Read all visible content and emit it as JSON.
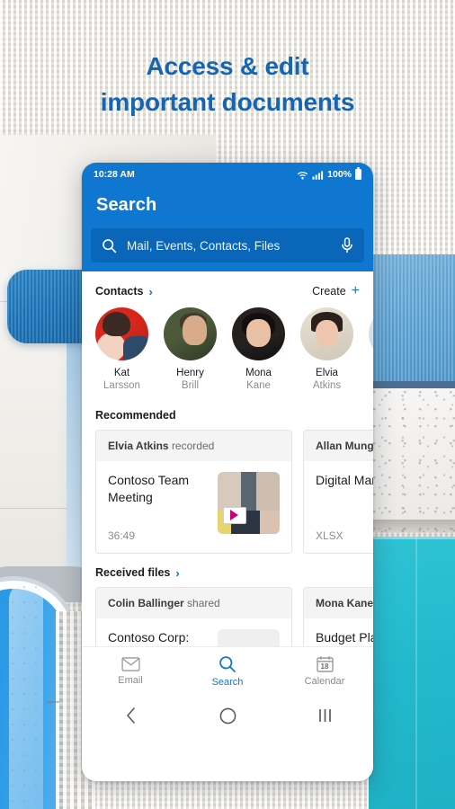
{
  "headline": {
    "line1": "Access & edit",
    "line2": "important documents",
    "color": "#1565b0"
  },
  "phone": {
    "status_bar": {
      "time": "10:28 AM",
      "battery": "100%",
      "wifi_icon": "wifi-icon",
      "signal_icon": "cellular-signal-icon",
      "battery_icon": "battery-full-icon"
    },
    "app_bar": {
      "title": "Search",
      "brand_color": "#0f77cf"
    },
    "search": {
      "placeholder": "Mail, Events, Contacts, Files",
      "value": "",
      "search_icon": "search-icon",
      "mic_icon": "microphone-icon"
    },
    "contacts_section": {
      "title": "Contacts",
      "chevron": "›",
      "create_label": "Create",
      "create_plus": "+",
      "people": [
        {
          "first": "Kat",
          "last": "Larsson",
          "avatar": "av-kat"
        },
        {
          "first": "Henry",
          "last": "Brill",
          "avatar": "av-henry"
        },
        {
          "first": "Mona",
          "last": "Kane",
          "avatar": "av-mona"
        },
        {
          "first": "Elvia",
          "last": "Atkins",
          "avatar": "av-elvia"
        },
        {
          "first": "",
          "last": "",
          "avatar": "av-partial"
        }
      ]
    },
    "recommended_section": {
      "title": "Recommended",
      "cards": [
        {
          "author": "Elvia Atkins",
          "action": "recorded",
          "title": "Contoso Team Meeting",
          "meta": "36:49",
          "thumb": "video-thumbnail"
        },
        {
          "author": "Allan Munga",
          "action": "",
          "title": "Digital Marketing Plan",
          "meta": "XLSX",
          "thumb": ""
        }
      ]
    },
    "received_section": {
      "title": "Received files",
      "chevron": "›",
      "cards": [
        {
          "author": "Colin Ballinger",
          "action": "shared",
          "title": "Contoso Corp: Client Deck",
          "meta": "",
          "thumb": "document-thumbnail"
        },
        {
          "author": "Mona Kane",
          "action": "s",
          "title": "Budget Plan Quarter",
          "meta": "",
          "thumb": ""
        }
      ]
    },
    "bottom_nav": {
      "tabs": [
        {
          "label": "Email",
          "icon": "envelope-icon",
          "active": false
        },
        {
          "label": "Search",
          "icon": "search-icon",
          "active": true
        },
        {
          "label": "Calendar",
          "icon": "calendar-icon",
          "active": false
        }
      ],
      "calendar_day": "18",
      "system": {
        "back": "back-icon",
        "home": "home-icon",
        "recents": "recents-icon"
      }
    }
  }
}
